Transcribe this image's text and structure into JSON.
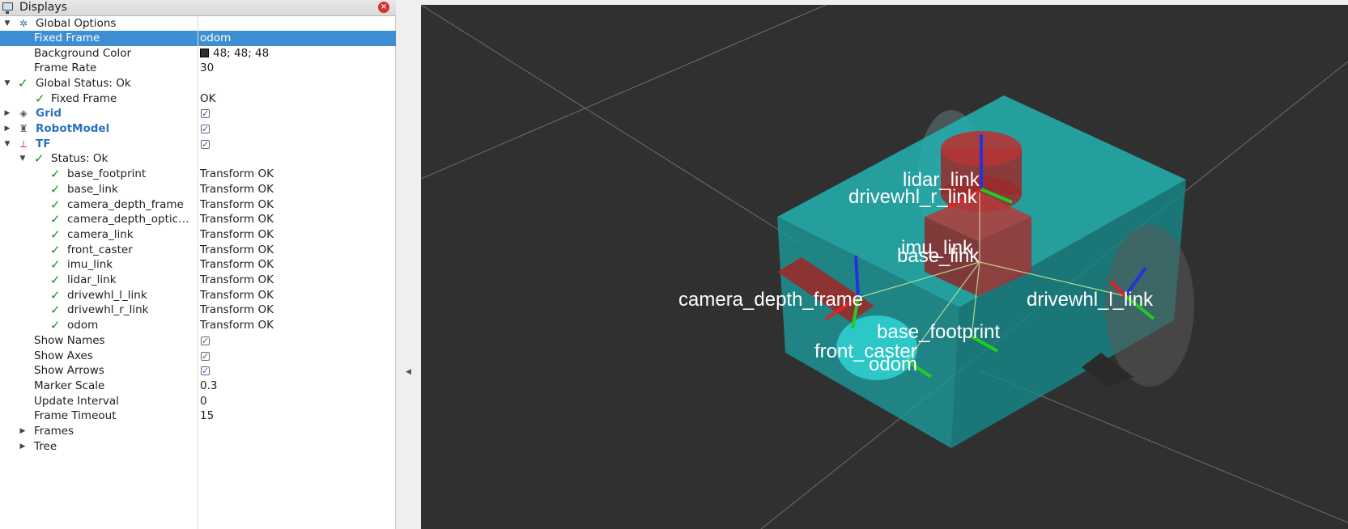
{
  "panel": {
    "title": "Displays",
    "rows": [
      {
        "name": "Global Options",
        "value": ""
      },
      {
        "name": "Fixed Frame",
        "value": "odom"
      },
      {
        "name": "Background Color",
        "value": "48; 48; 48"
      },
      {
        "name": "Frame Rate",
        "value": "30"
      },
      {
        "name": "Global Status: Ok",
        "value": ""
      },
      {
        "name": "Fixed Frame",
        "value": "OK"
      },
      {
        "name": "Grid",
        "value": ""
      },
      {
        "name": "RobotModel",
        "value": ""
      },
      {
        "name": "TF",
        "value": ""
      },
      {
        "name": "Status: Ok",
        "value": ""
      },
      {
        "name": "base_footprint",
        "value": "Transform OK"
      },
      {
        "name": "base_link",
        "value": "Transform OK"
      },
      {
        "name": "camera_depth_frame",
        "value": "Transform OK"
      },
      {
        "name": "camera_depth_optic…",
        "value": "Transform OK"
      },
      {
        "name": "camera_link",
        "value": "Transform OK"
      },
      {
        "name": "front_caster",
        "value": "Transform OK"
      },
      {
        "name": "imu_link",
        "value": "Transform OK"
      },
      {
        "name": "lidar_link",
        "value": "Transform OK"
      },
      {
        "name": "drivewhl_l_link",
        "value": "Transform OK"
      },
      {
        "name": "drivewhl_r_link",
        "value": "Transform OK"
      },
      {
        "name": "odom",
        "value": "Transform OK"
      },
      {
        "name": "Show Names",
        "value": ""
      },
      {
        "name": "Show Axes",
        "value": ""
      },
      {
        "name": "Show Arrows",
        "value": ""
      },
      {
        "name": "Marker Scale",
        "value": "0.3"
      },
      {
        "name": "Update Interval",
        "value": "0"
      },
      {
        "name": "Frame Timeout",
        "value": "15"
      },
      {
        "name": "Frames",
        "value": ""
      },
      {
        "name": "Tree",
        "value": ""
      }
    ]
  },
  "view": {
    "background_color": "#303030",
    "labels": {
      "lidar": "lidar_link",
      "drivewhl_r": "drivewhl_r_link",
      "imu": "imu_link",
      "base_link": "base_link",
      "camera": "camera_depth_frame",
      "drivewhl_l": "drivewhl_l_link",
      "base_footprint": "base_footprint",
      "front_caster": "front_caster",
      "odom": "odom"
    }
  },
  "colors": {
    "selection": "#3d8ed3",
    "chassis": "#22b5b5",
    "link_red": "#b23030",
    "status_ok": "#1f8a1f"
  }
}
